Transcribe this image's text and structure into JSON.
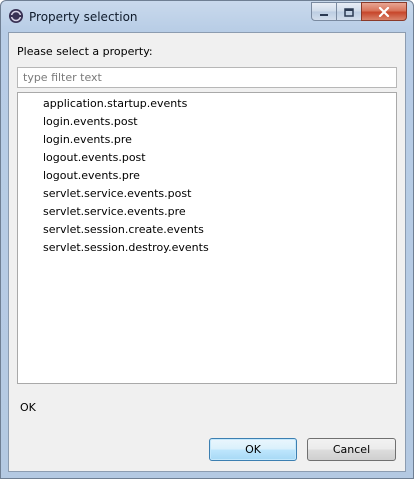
{
  "window": {
    "title": "Property selection"
  },
  "dialog": {
    "prompt": "Please select a property:",
    "filter": {
      "value": "",
      "placeholder": "type filter text"
    },
    "properties": [
      "application.startup.events",
      "login.events.post",
      "login.events.pre",
      "logout.events.post",
      "logout.events.pre",
      "servlet.service.events.post",
      "servlet.service.events.pre",
      "servlet.session.create.events",
      "servlet.session.destroy.events"
    ],
    "status": "OK"
  },
  "buttons": {
    "ok": "OK",
    "cancel": "Cancel"
  },
  "icons": {
    "app": "app-icon",
    "minimize": "minimize-icon",
    "maximize": "maximize-icon",
    "close": "close-icon"
  }
}
